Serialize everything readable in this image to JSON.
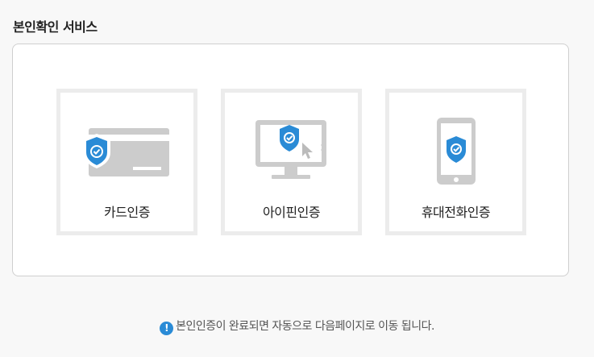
{
  "page_title": "본인확인 서비스",
  "options": [
    {
      "label": "카드인증",
      "icon": "credit-card-shield-icon"
    },
    {
      "label": "아이핀인증",
      "icon": "monitor-shield-cursor-icon"
    },
    {
      "label": "휴대전화인증",
      "icon": "mobile-phone-shield-icon"
    }
  ],
  "notice": {
    "icon": "exclamation-circle-icon",
    "text": "본인인증이 완료되면 자동으로 다음페이지로 이동 됩니다."
  },
  "colors": {
    "accent": "#2a8bd6",
    "icon_gray": "#cccccc",
    "tile_border": "#ececec",
    "panel_border": "#cfcfcf"
  }
}
